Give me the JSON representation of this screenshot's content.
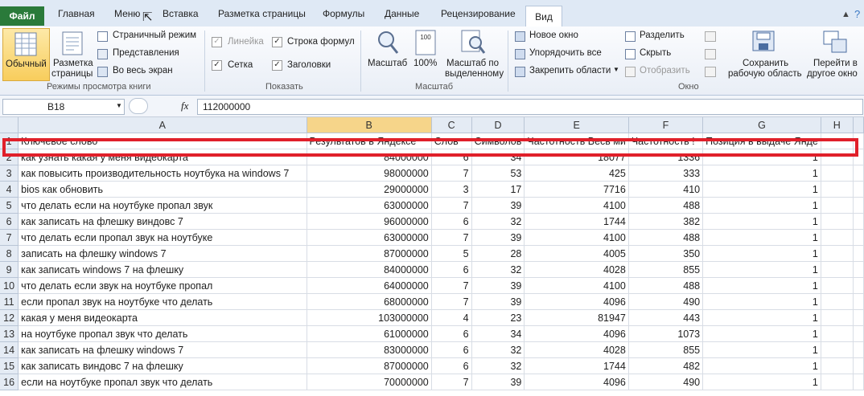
{
  "tabs": {
    "file": "Файл",
    "items": [
      "Главная",
      "Меню",
      "Вставка",
      "Разметка страницы",
      "Формулы",
      "Данные",
      "Рецензирование"
    ],
    "active": "Вид"
  },
  "ribbon": {
    "views": {
      "normal": "Обычный",
      "page_layout_1": "Разметка",
      "page_layout_2": "страницы",
      "page_mode": "Страничный режим",
      "custom_views": "Представления",
      "full_screen": "Во весь экран",
      "label": "Режимы просмотра книги"
    },
    "show": {
      "ruler": "Линейка",
      "formula_bar": "Строка формул",
      "grid": "Сетка",
      "headings": "Заголовки",
      "label": "Показать"
    },
    "zoom": {
      "zoom": "Масштаб",
      "hundred": "100%",
      "hundred_icon": "100",
      "zoom_sel_1": "Масштаб по",
      "zoom_sel_2": "выделенному",
      "label": "Масштаб"
    },
    "window": {
      "new_window": "Новое окно",
      "arrange_all": "Упорядочить все",
      "freeze": "Закрепить области",
      "split": "Разделить",
      "hide": "Скрыть",
      "unhide": "Отобразить",
      "save_ws_1": "Сохранить",
      "save_ws_2": "рабочую область",
      "switch_1": "Перейти в",
      "switch_2": "другое окно",
      "label": "Окно"
    }
  },
  "formula_bar": {
    "cell": "B18",
    "fx": "fx",
    "value": "112000000"
  },
  "columns": [
    "A",
    "B",
    "C",
    "D",
    "E",
    "F",
    "G",
    "H"
  ],
  "header_row": {
    "num": "1",
    "cells": [
      "Ключевое слово",
      "Результатов в Яндексе",
      "Слов",
      "Символов",
      "Частотность Весь ми",
      "Частотность !",
      "Позиция в выдаче Янде",
      ""
    ]
  },
  "rows": [
    {
      "n": "2",
      "a": "как узнать какая у меня видеокарта",
      "b": "84000000",
      "c": "6",
      "d": "34",
      "e": "18077",
      "f": "1336",
      "g": "1"
    },
    {
      "n": "3",
      "a": "как повысить производительность ноутбука на windows 7",
      "b": "98000000",
      "c": "7",
      "d": "53",
      "e": "425",
      "f": "333",
      "g": "1"
    },
    {
      "n": "4",
      "a": "bios как обновить",
      "b": "29000000",
      "c": "3",
      "d": "17",
      "e": "7716",
      "f": "410",
      "g": "1"
    },
    {
      "n": "5",
      "a": "что делать если на ноутбуке пропал звук",
      "b": "63000000",
      "c": "7",
      "d": "39",
      "e": "4100",
      "f": "488",
      "g": "1"
    },
    {
      "n": "6",
      "a": "как записать на флешку виндовс 7",
      "b": "96000000",
      "c": "6",
      "d": "32",
      "e": "1744",
      "f": "382",
      "g": "1"
    },
    {
      "n": "7",
      "a": "что делать если пропал звук на ноутбуке",
      "b": "63000000",
      "c": "7",
      "d": "39",
      "e": "4100",
      "f": "488",
      "g": "1"
    },
    {
      "n": "8",
      "a": "записать на флешку windows 7",
      "b": "87000000",
      "c": "5",
      "d": "28",
      "e": "4005",
      "f": "350",
      "g": "1"
    },
    {
      "n": "9",
      "a": "как записать windows 7 на флешку",
      "b": "84000000",
      "c": "6",
      "d": "32",
      "e": "4028",
      "f": "855",
      "g": "1"
    },
    {
      "n": "10",
      "a": "что делать если звук на ноутбуке пропал",
      "b": "64000000",
      "c": "7",
      "d": "39",
      "e": "4100",
      "f": "488",
      "g": "1"
    },
    {
      "n": "11",
      "a": "если пропал звук на ноутбуке что делать",
      "b": "68000000",
      "c": "7",
      "d": "39",
      "e": "4096",
      "f": "490",
      "g": "1"
    },
    {
      "n": "12",
      "a": "какая у меня видеокарта",
      "b": "103000000",
      "c": "4",
      "d": "23",
      "e": "81947",
      "f": "443",
      "g": "1"
    },
    {
      "n": "13",
      "a": "на ноутбуке пропал звук что делать",
      "b": "61000000",
      "c": "6",
      "d": "34",
      "e": "4096",
      "f": "1073",
      "g": "1"
    },
    {
      "n": "14",
      "a": "как записать на флешку windows 7",
      "b": "83000000",
      "c": "6",
      "d": "32",
      "e": "4028",
      "f": "855",
      "g": "1"
    },
    {
      "n": "15",
      "a": "как записать виндовс 7 на флешку",
      "b": "87000000",
      "c": "6",
      "d": "32",
      "e": "1744",
      "f": "482",
      "g": "1"
    },
    {
      "n": "16",
      "a": "если на ноутбуке пропал звук что делать",
      "b": "70000000",
      "c": "7",
      "d": "39",
      "e": "4096",
      "f": "490",
      "g": "1"
    }
  ]
}
